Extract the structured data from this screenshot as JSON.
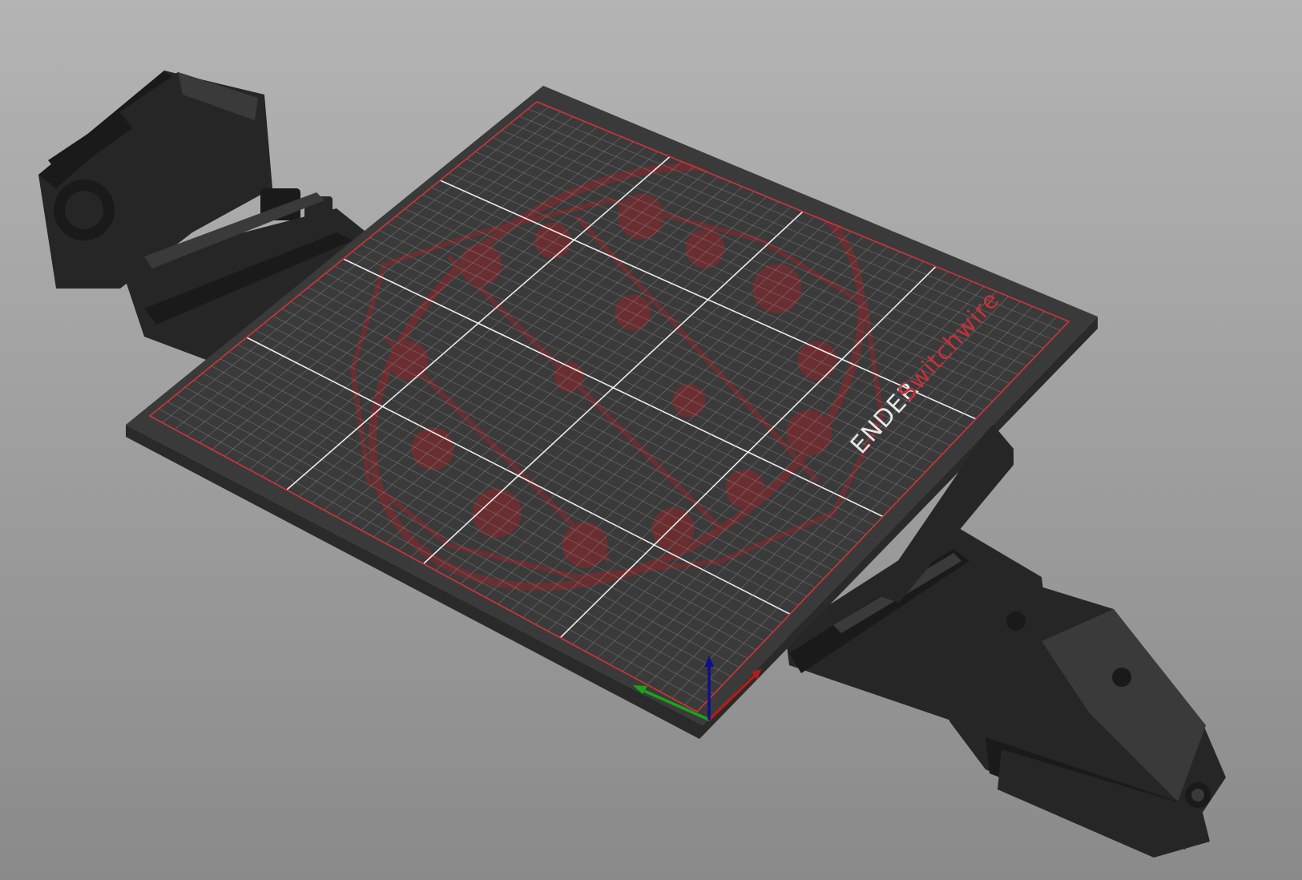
{
  "viewport": {
    "name": "3D plater view",
    "background_top": "#b4b4b4",
    "background_bottom": "#8a8a8a"
  },
  "bed": {
    "brand": "ENDER",
    "model": "Switchwire",
    "surface_color": "#3a3a3a",
    "edge_color": "#2a2a2a",
    "grid_minor_color": "#8f8f8f",
    "grid_major_color": "#ffffff",
    "border_color": "#d0343a",
    "logo_color": "#7a2b2f",
    "brand_color": "#e6e6e6",
    "model_color": "#c8303a"
  },
  "axes": {
    "x_color": "#b21c1c",
    "y_color": "#1aa31a",
    "z_color": "#10108c"
  },
  "hardware": {
    "body_color": "#262626",
    "shade_color": "#1a1a1a",
    "highlight_color": "#3a3a3a"
  }
}
